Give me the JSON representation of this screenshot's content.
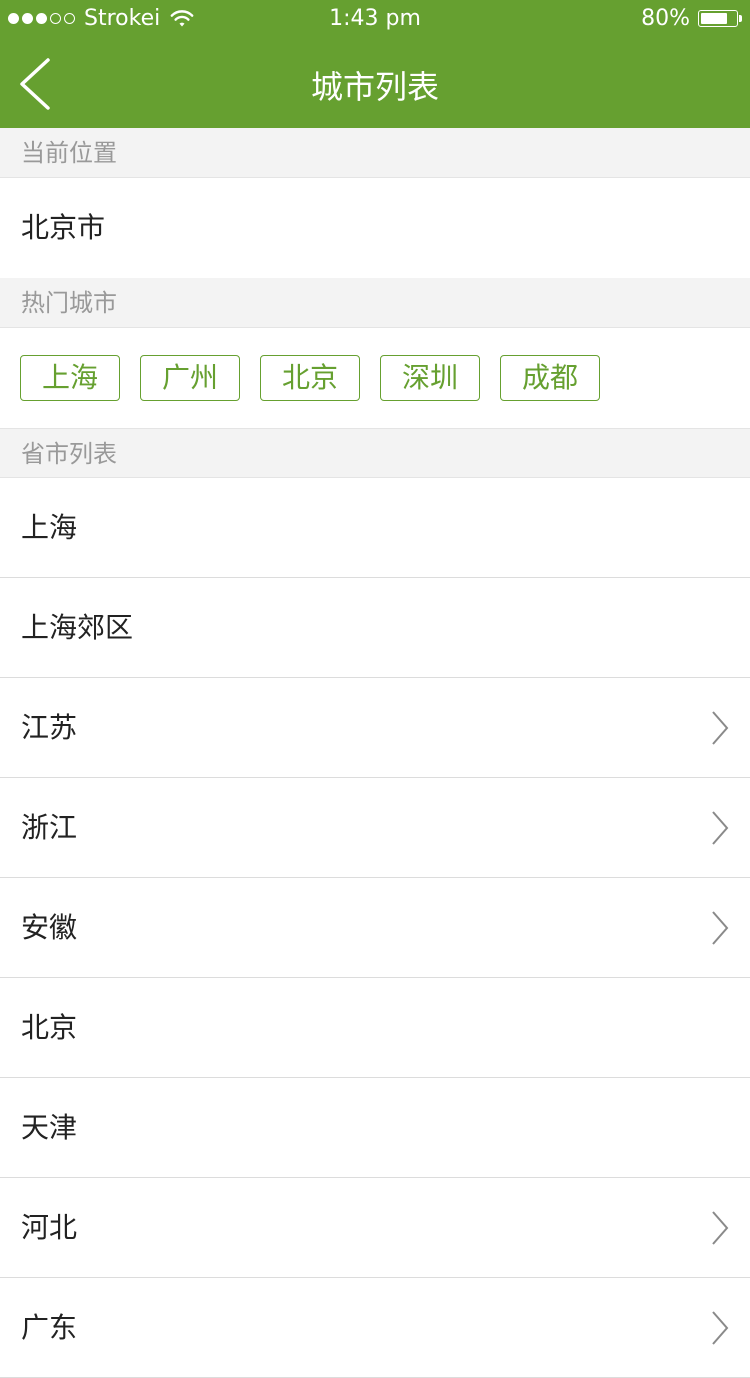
{
  "status_bar": {
    "signal_filled": 3,
    "signal_total": 5,
    "carrier": "Strokei",
    "time": "1:43 pm",
    "battery_percent_text": "80%",
    "battery_level": 0.8
  },
  "nav": {
    "back_icon": "chevron-left-icon",
    "title": "城市列表"
  },
  "sections": {
    "current": {
      "header": "当前位置",
      "city": "北京市"
    },
    "hot": {
      "header": "热门城市",
      "cities": [
        "上海",
        "广州",
        "北京",
        "深圳",
        "成都"
      ]
    },
    "province": {
      "header": "省市列表"
    }
  },
  "provinces": [
    {
      "name": "上海",
      "has_children": false
    },
    {
      "name": "上海郊区",
      "has_children": false
    },
    {
      "name": "江苏",
      "has_children": true
    },
    {
      "name": "浙江",
      "has_children": true
    },
    {
      "name": "安徽",
      "has_children": true
    },
    {
      "name": "北京",
      "has_children": false
    },
    {
      "name": "天津",
      "has_children": false
    },
    {
      "name": "河北",
      "has_children": true
    },
    {
      "name": "广东",
      "has_children": true
    }
  ],
  "colors": {
    "accent": "#66a030",
    "section_bg": "#f3f3f3",
    "section_text": "#999999",
    "divider": "#dcdcdc"
  }
}
